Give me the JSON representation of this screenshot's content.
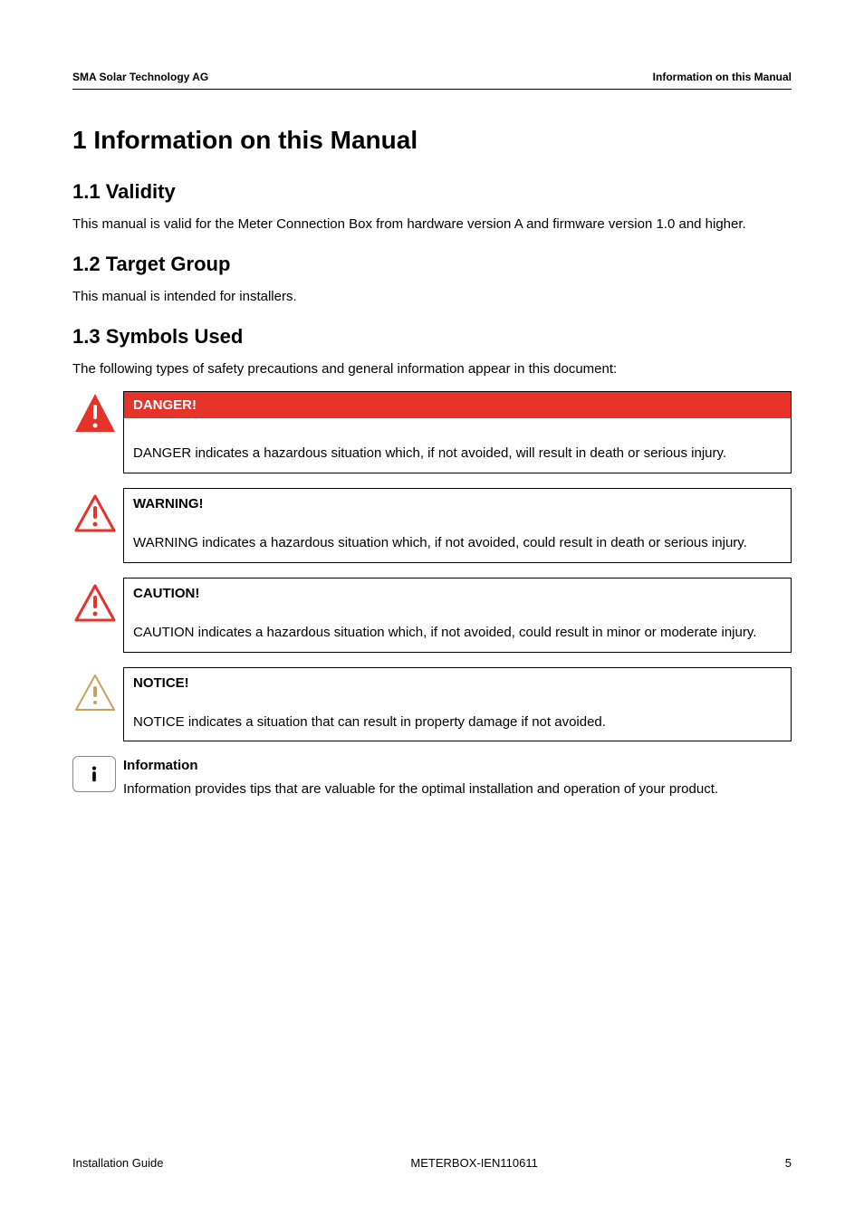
{
  "header": {
    "left": "SMA Solar Technology AG",
    "right": "Information on this Manual"
  },
  "h1": "1  Information on this Manual",
  "s11": {
    "title": "1.1  Validity",
    "body": "This manual is valid for the Meter Connection Box from hardware version A and firmware version 1.0 and higher."
  },
  "s12": {
    "title": "1.2  Target Group",
    "body": "This manual is intended for installers."
  },
  "s13": {
    "title": "1.3  Symbols Used",
    "intro": "The following types of safety precautions and general information appear in this document:"
  },
  "danger": {
    "label": "DANGER!",
    "text": "DANGER indicates a hazardous situation which, if not avoided, will result in death or serious injury."
  },
  "warning": {
    "label": "WARNING!",
    "text": "WARNING indicates a hazardous situation which, if not avoided, could result in death or serious injury."
  },
  "caution": {
    "label": "CAUTION!",
    "text": "CAUTION indicates a hazardous situation which, if not avoided, could result in minor or moderate injury."
  },
  "notice": {
    "label": "NOTICE!",
    "text": "NOTICE indicates a situation that can result in property damage if not avoided."
  },
  "info": {
    "label": "Information",
    "text": "Information provides tips that are valuable for the optimal installation and operation of your product."
  },
  "footer": {
    "left": "Installation Guide",
    "center": "METERBOX-IEN110611",
    "right": "5"
  }
}
